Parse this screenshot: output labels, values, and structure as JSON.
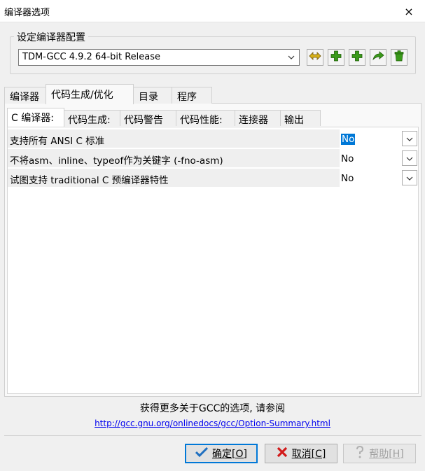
{
  "window": {
    "title": "编译器选项",
    "close_icon": "×"
  },
  "config": {
    "group_label": "设定编译器配置",
    "selected": "TDM-GCC 4.9.2 64-bit Release",
    "toolbar_icons": [
      "rename-icon",
      "add-icon",
      "add-icon",
      "export-icon",
      "delete-icon"
    ]
  },
  "tabs": [
    "编译器",
    "代码生成/优化",
    "目录",
    "程序"
  ],
  "subtabs": [
    "C 编译器:",
    "代码生成:",
    "代码警告",
    "代码性能:",
    "连接器",
    "输出"
  ],
  "options": [
    {
      "label": "支持所有 ANSI C 标准",
      "value": "No"
    },
    {
      "label": "不将asm、inline、typeof作为关键字 (-fno-asm)",
      "value": "No"
    },
    {
      "label": "试图支持 traditional C 预编译器特性",
      "value": "No"
    }
  ],
  "info": {
    "text": "获得更多关于GCC的选项, 请参阅",
    "link": "http://gcc.gnu.org/onlinedocs/gcc/Option-Summary.html"
  },
  "buttons": {
    "ok": "确定[O]",
    "cancel": "取消[C]",
    "help": "帮助[H]"
  },
  "colors": {
    "accent": "#0078d7",
    "green": "#3a9a1a",
    "red": "#d21a1a"
  }
}
